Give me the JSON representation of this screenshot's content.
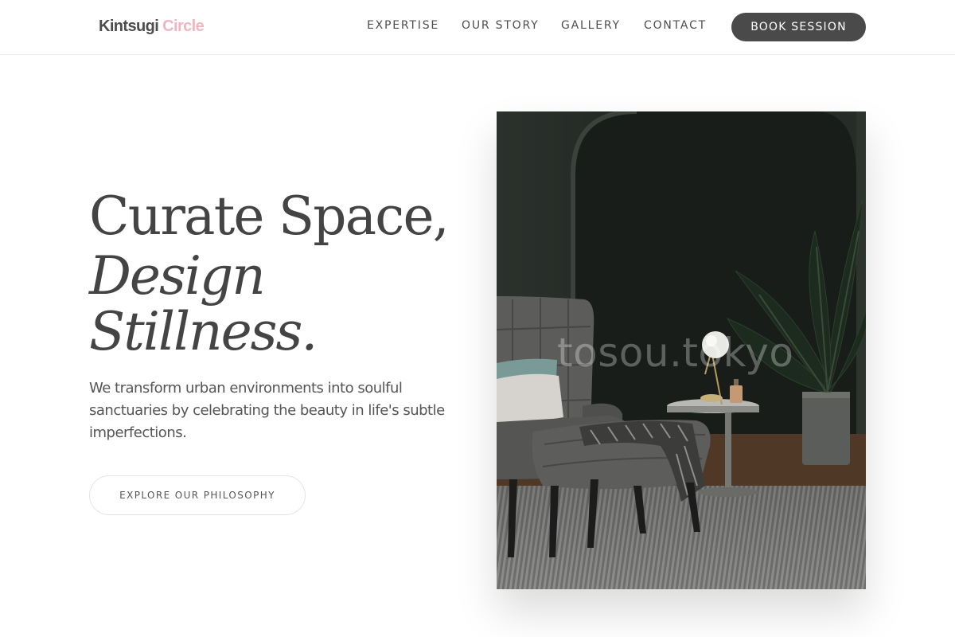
{
  "header": {
    "brand": {
      "primary": "Kintsugi",
      "accent": "Circle"
    },
    "nav": [
      {
        "label": "EXPERTISE"
      },
      {
        "label": "OUR STORY"
      },
      {
        "label": "GALLERY"
      },
      {
        "label": "CONTACT"
      }
    ],
    "cta_label": "BOOK SESSION"
  },
  "hero": {
    "title_line_1": "Curate Space,",
    "title_line_2": "Design",
    "title_line_3": "Stillness.",
    "description": "We transform urban environments into soulful sanctuaries by celebrating the beauty in life's subtle imperfections.",
    "button_label": "EXPLORE OUR PHILOSOPHY"
  },
  "photo": {
    "watermark": "tosou.tokyo"
  },
  "colors": {
    "brand_accent": "#efb6c2",
    "text_dark": "#4a4a4a",
    "button_dark": "#4a4a4a"
  }
}
